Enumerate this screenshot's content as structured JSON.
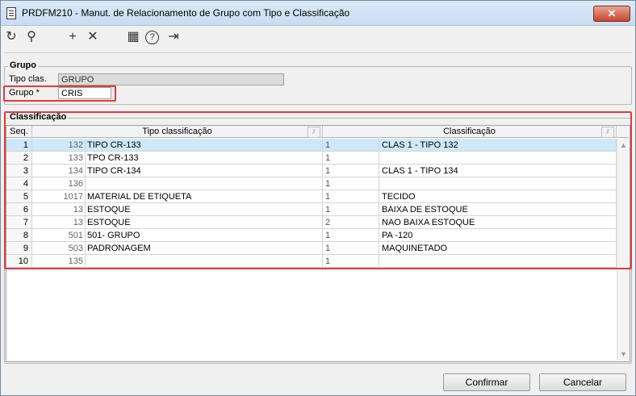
{
  "window": {
    "title": "PRDFM210 - Manut. de Relacionamento de Grupo com Tipo e Classificação",
    "close_glyph": "✕"
  },
  "toolbar": {
    "icons": [
      {
        "name": "undo-icon",
        "glyph": "↻"
      },
      {
        "name": "search-icon",
        "glyph": "⚲"
      },
      {
        "name": "add-icon",
        "glyph": "+"
      },
      {
        "name": "remove-icon",
        "glyph": "✕"
      },
      {
        "name": "calendar-icon",
        "glyph": "▦"
      },
      {
        "name": "help-icon",
        "glyph": "?"
      },
      {
        "name": "exit-icon",
        "glyph": "⇥"
      }
    ]
  },
  "grupo_section": {
    "title": "Grupo",
    "tipo_label": "Tipo clas.",
    "tipo_value": "GRUPO",
    "grupo_label": "Grupo *",
    "grupo_value": "CRIS"
  },
  "classificacao_section": {
    "title": "Classificação",
    "columns": {
      "seq": "Seq.",
      "tipo": "Tipo classificação",
      "clas": "Classificação"
    },
    "rows": [
      {
        "seq": "1",
        "num": "132",
        "tipo": "TIPO CR-133",
        "k": "1",
        "clas": "CLAS 1 - TIPO 132"
      },
      {
        "seq": "2",
        "num": "133",
        "tipo": "TPO CR-133",
        "k": "1",
        "clas": ""
      },
      {
        "seq": "3",
        "num": "134",
        "tipo": "TIPO CR-134",
        "k": "1",
        "clas": "CLAS 1 - TIPO 134"
      },
      {
        "seq": "4",
        "num": "136",
        "tipo": "",
        "k": "1",
        "clas": ""
      },
      {
        "seq": "5",
        "num": "1017",
        "tipo": "MATERIAL DE ETIQUETA",
        "k": "1",
        "clas": "TECIDO"
      },
      {
        "seq": "6",
        "num": "13",
        "tipo": "ESTOQUE",
        "k": "1",
        "clas": "BAIXA DE ESTOQUE"
      },
      {
        "seq": "7",
        "num": "13",
        "tipo": "ESTOQUE",
        "k": "2",
        "clas": "NAO BAIXA ESTOQUE"
      },
      {
        "seq": "8",
        "num": "501",
        "tipo": "501- GRUPO",
        "k": "1",
        "clas": "PA -120"
      },
      {
        "seq": "9",
        "num": "503",
        "tipo": "PADRONAGEM",
        "k": "1",
        "clas": "MAQUINETADO"
      },
      {
        "seq": "10",
        "num": "135",
        "tipo": "",
        "k": "1",
        "clas": ""
      }
    ]
  },
  "buttons": {
    "confirm": "Confirmar",
    "cancel": "Cancelar"
  },
  "colors": {
    "highlight": "#e23b3b",
    "selected_row": "#cde8f9"
  }
}
